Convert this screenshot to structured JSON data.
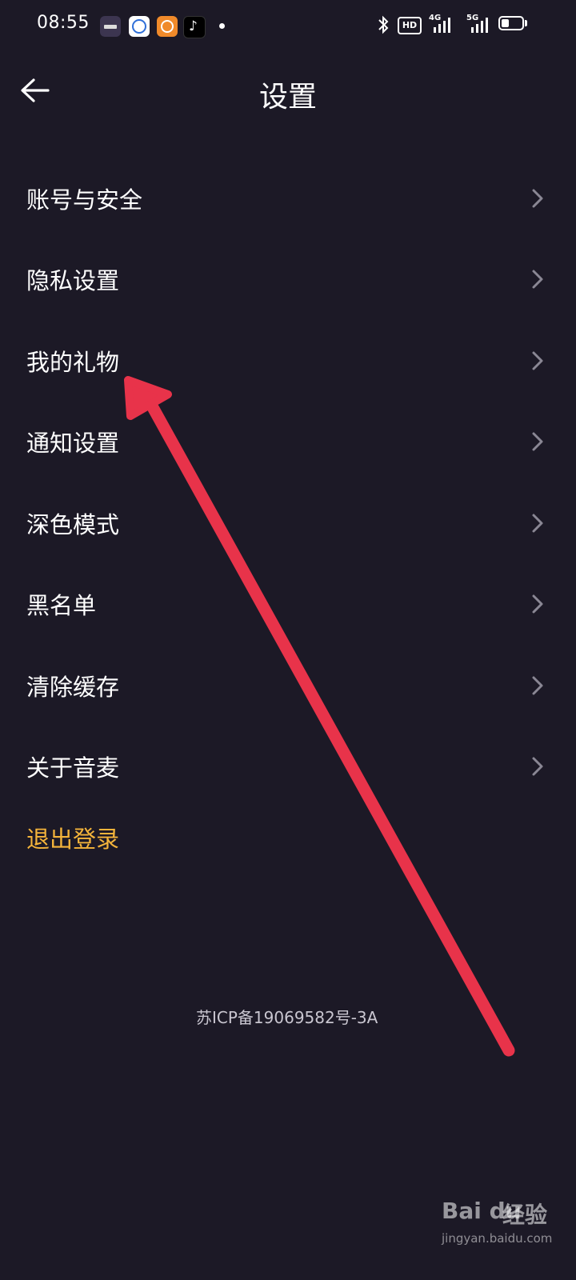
{
  "status_bar": {
    "time": "08:55",
    "hd_label": "HD",
    "net1_label": "4G",
    "net2_label": "5G"
  },
  "header": {
    "title": "设置",
    "back_icon": "back-arrow-icon"
  },
  "settings": {
    "items": [
      {
        "label": "账号与安全"
      },
      {
        "label": "隐私设置"
      },
      {
        "label": "我的礼物"
      },
      {
        "label": "通知设置"
      },
      {
        "label": "深色模式"
      },
      {
        "label": "黑名单"
      },
      {
        "label": "清除缓存"
      },
      {
        "label": "关于音麦"
      }
    ],
    "logout_label": "退出登录"
  },
  "footer": {
    "icp": "苏ICP备19069582号-3A"
  },
  "watermark": {
    "brand": "Bai du",
    "cn": "经验",
    "url": "jingyan.baidu.com"
  },
  "colors": {
    "background": "#1c1926",
    "logout": "#f4b43b",
    "annotation": "#e8334a"
  }
}
